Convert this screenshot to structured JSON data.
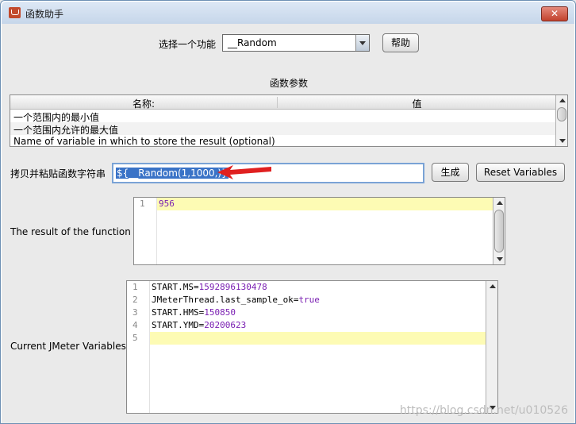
{
  "window": {
    "title": "函数助手",
    "close_label": "✕"
  },
  "function_row": {
    "label": "选择一个功能",
    "selected": "__Random",
    "help_label": "帮助"
  },
  "params": {
    "section_title": "函数参数",
    "columns": [
      "名称:",
      "值"
    ],
    "rows": [
      {
        "name": "一个范围内的最小值",
        "value": ""
      },
      {
        "name": "一个范围内允许的最大值",
        "value": ""
      },
      {
        "name": "Name of variable in which to store the result (optional)",
        "value": ""
      }
    ]
  },
  "copy_row": {
    "label": "拷贝并粘贴函数字符串",
    "value": "${__Random(1,1000,)}",
    "generate_label": "生成",
    "reset_label": "Reset Variables"
  },
  "result": {
    "label": "The result of the function is",
    "lines": [
      {
        "num": "1",
        "text": "956"
      }
    ]
  },
  "variables": {
    "label": "Current JMeter Variables",
    "lines": [
      {
        "num": "1",
        "key": "START.MS",
        "value": "1592896130478"
      },
      {
        "num": "2",
        "key": "JMeterThread.last_sample_ok",
        "value": "true"
      },
      {
        "num": "3",
        "key": "START.HMS",
        "value": "150850"
      },
      {
        "num": "4",
        "key": "START.YMD",
        "value": "20200623"
      },
      {
        "num": "5",
        "key": "",
        "value": ""
      }
    ]
  },
  "watermark": "https://blog.csdn.net/u010526",
  "colors": {
    "accent": "#3a73c7",
    "highlight": "#fdfbb4",
    "value_text": "#7a1fb2",
    "arrow": "#e02020"
  }
}
